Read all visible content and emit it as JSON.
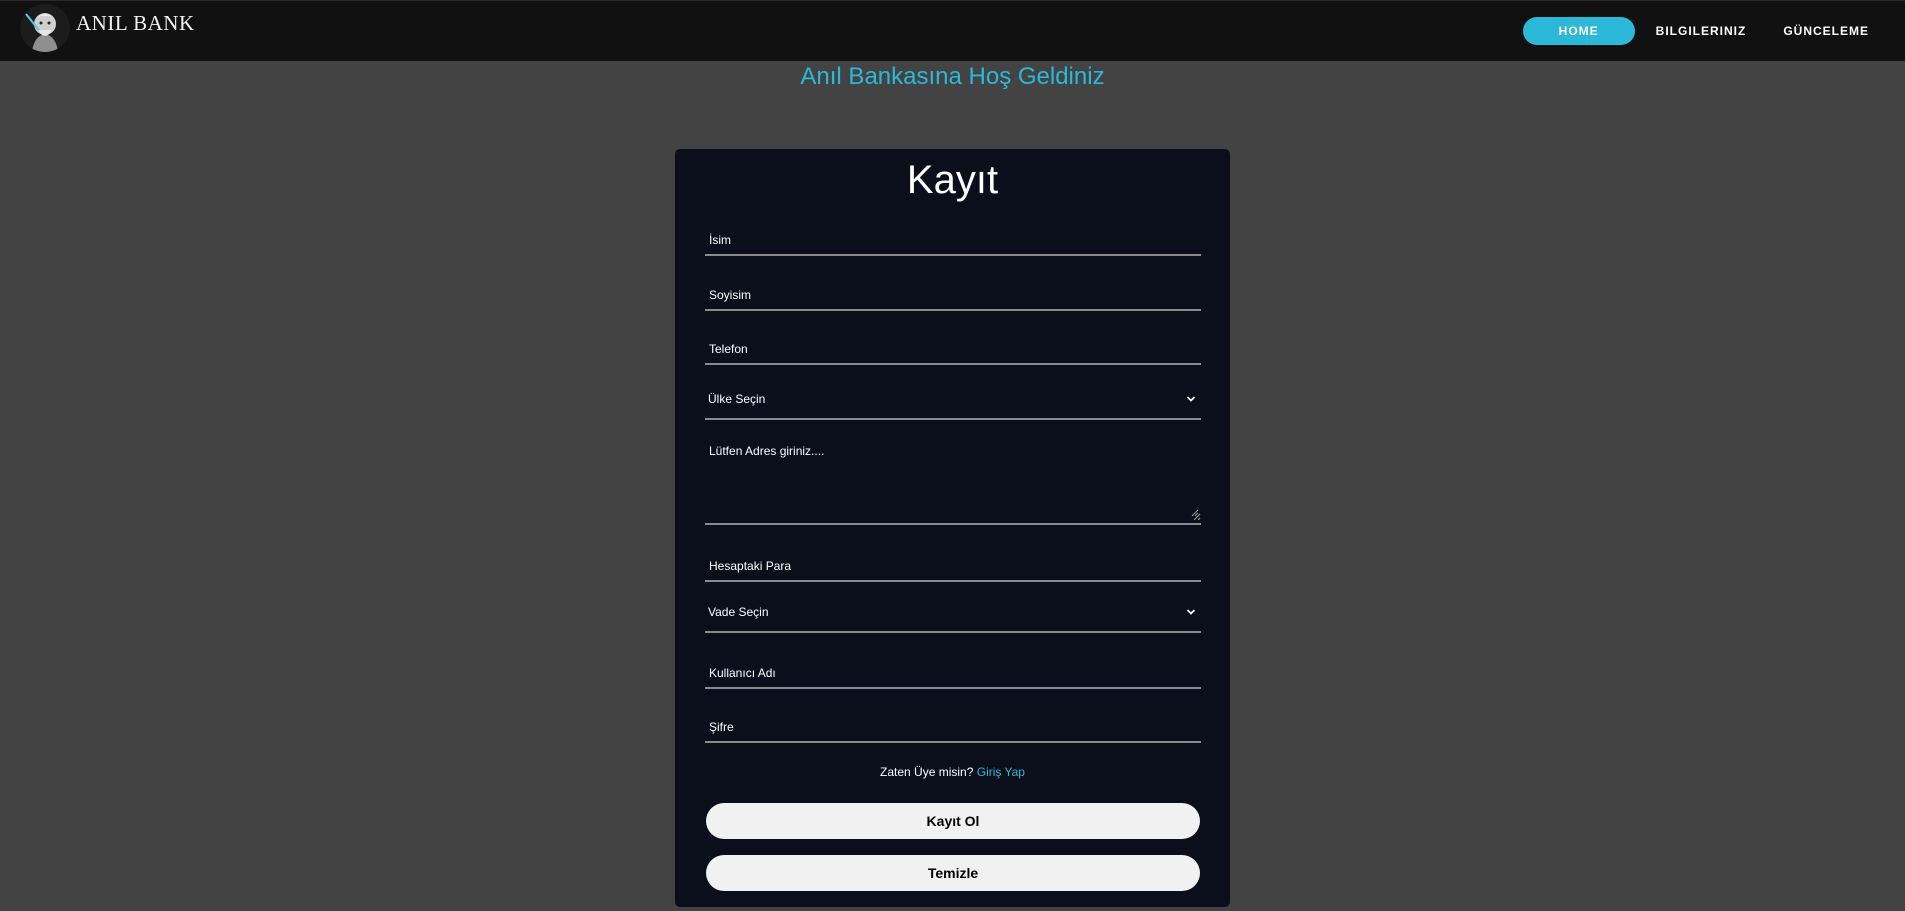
{
  "brand": {
    "name": "ANIL BANK",
    "logo_icon": "warrior-logo-icon"
  },
  "nav": {
    "items": [
      {
        "label": "HOME",
        "active": true
      },
      {
        "label": "BILGILERINIZ",
        "active": false
      },
      {
        "label": "GÜNCELEME",
        "active": false
      }
    ]
  },
  "welcome_text": "Anıl Bankasına Hoş Geldiniz",
  "form": {
    "title": "Kayıt",
    "fields": {
      "isim": {
        "placeholder": "İsim",
        "value": ""
      },
      "soyisim": {
        "placeholder": "Soyisim",
        "value": ""
      },
      "telefon": {
        "placeholder": "Telefon",
        "value": ""
      },
      "ulke": {
        "selected": "Ülke Seçin"
      },
      "adres": {
        "placeholder": "Lütfen Adres giriniz....",
        "value": ""
      },
      "para": {
        "placeholder": "Hesaptaki Para",
        "value": ""
      },
      "vade": {
        "selected": "Vade Seçin"
      },
      "kullanici": {
        "placeholder": "Kullanıcı Adı",
        "value": ""
      },
      "sifre": {
        "placeholder": "Şifre",
        "value": ""
      }
    },
    "login_prompt": "Zaten Üye misin?",
    "login_link": "Giriş Yap",
    "submit_label": "Kayıt Ol",
    "clear_label": "Temizle"
  },
  "colors": {
    "accent": "#2bb8d9",
    "navbar_bg": "#111111",
    "page_bg": "#434343",
    "card_bg": "#0a0f1b",
    "button_bg": "#f1f1f1"
  }
}
